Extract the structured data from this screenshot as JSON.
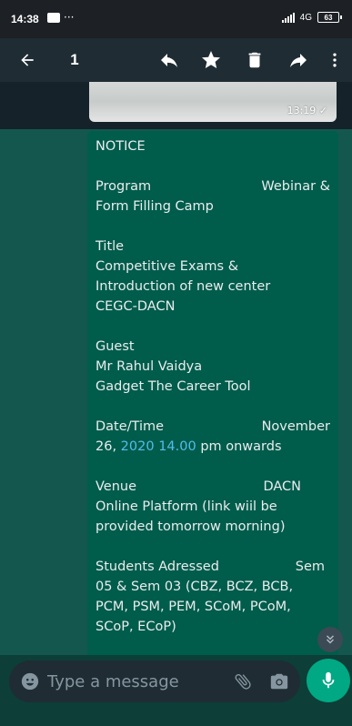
{
  "status_bar": {
    "time": "14:38",
    "dots": "···",
    "network": "4G",
    "battery": "63"
  },
  "toolbar": {
    "selected_count": "1"
  },
  "previous_message": {
    "time": "13:19 ✓"
  },
  "message": {
    "heading": "NOTICE",
    "program_label": "Program",
    "program_value_1": "Webinar &",
    "program_value_2": "Form Filling Camp",
    "title_label": "Title",
    "title_line1": "Competitive Exams &",
    "title_line2": "Introduction of new center",
    "title_line3": "CEGC-DACN",
    "guest_label": "Guest",
    "guest_name": "Mr Rahul Vaidya",
    "guest_org": "Gadget The Career Tool",
    "datetime_label": "Date/Time",
    "datetime_month": "November",
    "datetime_day": "26,",
    "datetime_year": "2020",
    "datetime_time": "14.00",
    "datetime_rest": "pm onwards",
    "venue_label": "Venue",
    "venue_value": "DACN",
    "venue_line2": "Online Platform (link wiil be",
    "venue_line3": "provided tomorrow morning)",
    "students_label": "Students Adressed",
    "students_sem": "Sem",
    "students_line2": "05 & Sem 03 (CBZ, BCZ, BCB,",
    "students_line3": "PCM, PSM, PEM, SCoM, PCoM,",
    "students_line4": "SCoP, ECoP)"
  },
  "input": {
    "placeholder": "Type a message"
  },
  "colors": {
    "accent": "#00a884",
    "bubble": "#005c4b",
    "link_blue": "#53bdeb",
    "toolbar": "#1f2c33"
  },
  "icons": [
    "back-arrow-icon",
    "reply-icon",
    "star-icon",
    "trash-icon",
    "forward-icon",
    "more-vert-icon",
    "emoji-icon",
    "attach-icon",
    "camera-icon",
    "mic-icon",
    "chevron-double-down-icon"
  ]
}
